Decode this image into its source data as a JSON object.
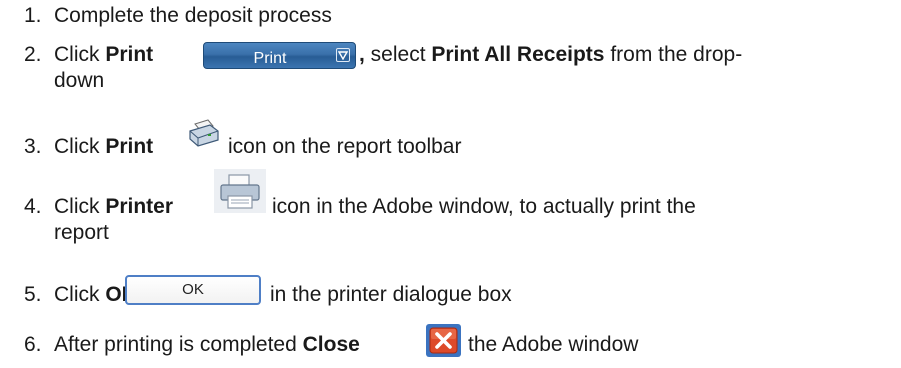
{
  "steps": [
    {
      "num": "1.",
      "text": "Complete the deposit process"
    },
    {
      "num": "2.",
      "pre": "Click ",
      "bold": "Print",
      "post_bold": ",",
      "post": " select ",
      "bold2": "Print All Receipts",
      "post2": " from the drop-",
      "cont": "down"
    },
    {
      "num": "3.",
      "pre": "Click ",
      "bold": "Print",
      "post": " icon on the report toolbar"
    },
    {
      "num": "4.",
      "pre": "Click ",
      "bold": "Printer",
      "post": " icon in the Adobe window, to actually print the",
      "cont": "report"
    },
    {
      "num": "5.",
      "pre": "Click ",
      "bold": "OK",
      "post": " in the printer dialogue box"
    },
    {
      "num": "6.",
      "pre": "After printing is completed ",
      "bold": "Close",
      "post": " the Adobe window"
    }
  ],
  "buttons": {
    "print_dropdown_label": "Print",
    "ok_label": "OK"
  },
  "icons": {
    "report_print": "printer-icon",
    "adobe_printer": "printer-icon",
    "close": "close-icon"
  }
}
